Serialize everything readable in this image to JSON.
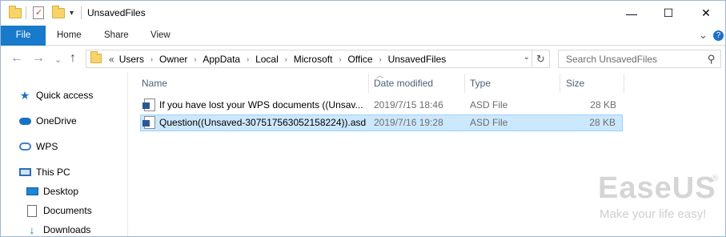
{
  "window": {
    "title": "UnsavedFiles",
    "controls": {
      "minimize": "—",
      "maximize": "☐",
      "close": "✕"
    }
  },
  "ribbon": {
    "tabs": [
      "File",
      "Home",
      "Share",
      "View"
    ],
    "expand_glyph": "⌄",
    "help_glyph": "?"
  },
  "address": {
    "overflow": "«",
    "crumbs": [
      "Users",
      "Owner",
      "AppData",
      "Local",
      "Microsoft",
      "Office",
      "UnsavedFiles"
    ],
    "separator": "›",
    "search_placeholder": "Search UnsavedFiles"
  },
  "nav": {
    "back": "←",
    "forward": "→",
    "recent": "⌄",
    "up": "↑",
    "items": [
      {
        "label": "Quick access",
        "icon": "star-icon"
      },
      {
        "label": "OneDrive",
        "icon": "onedrive-cloud-icon"
      },
      {
        "label": "WPS",
        "icon": "wps-cloud-icon"
      },
      {
        "label": "This PC",
        "icon": "computer-icon"
      },
      {
        "label": "Desktop",
        "icon": "desktop-icon"
      },
      {
        "label": "Documents",
        "icon": "documents-icon"
      },
      {
        "label": "Downloads",
        "icon": "downloads-icon"
      }
    ]
  },
  "columns": {
    "name": "Name",
    "date": "Date modified",
    "type": "Type",
    "size": "Size"
  },
  "files": [
    {
      "name": "If you have lost your WPS documents ((Unsav...",
      "date": "2019/7/15 18:46",
      "type": "ASD File",
      "size": "28 KB",
      "selected": false
    },
    {
      "name": "Question((Unsaved-307517563052158224)).asd",
      "date": "2019/7/16 19:28",
      "type": "ASD File",
      "size": "28 KB",
      "selected": true
    }
  ],
  "watermark": {
    "brand": "EaseUS",
    "registered": "®",
    "tagline": "Make your life easy!"
  },
  "colors": {
    "accent": "#1979ca",
    "selection": "#cce8ff",
    "selection_border": "#99d1ff"
  }
}
